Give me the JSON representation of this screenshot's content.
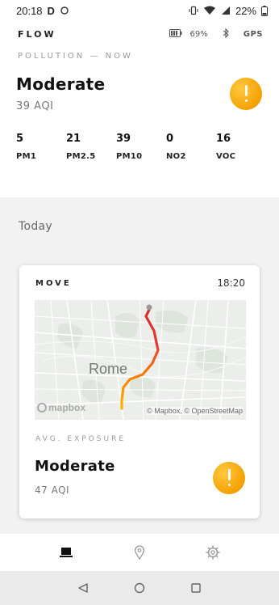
{
  "status_bar": {
    "time": "20:18",
    "battery": "22%"
  },
  "header": {
    "brand": "FLOW",
    "device_battery": "69%",
    "gps": "GPS"
  },
  "pollution": {
    "label": "POLLUTION — NOW",
    "level": "Moderate",
    "aqi": "39 AQI",
    "metrics": [
      {
        "value": "5",
        "name": "PM1"
      },
      {
        "value": "21",
        "name": "PM2.5"
      },
      {
        "value": "39",
        "name": "PM10"
      },
      {
        "value": "0",
        "name": "NO2"
      },
      {
        "value": "16",
        "name": "VOC"
      }
    ]
  },
  "today": {
    "label": "Today"
  },
  "move_card": {
    "title": "MOVE",
    "time": "18:20",
    "map": {
      "city": "Rome",
      "logo": "mapbox",
      "attribution": "© Mapbox, © OpenStreetMap"
    },
    "exposure_label": "AVG. EXPOSURE",
    "level": "Moderate",
    "aqi": "47 AQI"
  },
  "colors": {
    "alert": "#f5a000",
    "route_high": "#e53935",
    "route_mid": "#f57c00",
    "route_low": "#ffb300"
  },
  "icons": {
    "status": [
      "d-app-icon",
      "cloud-icon",
      "vibrate-icon",
      "wifi-icon",
      "signal-icon",
      "battery-icon"
    ],
    "header": [
      "device-battery-icon",
      "bluetooth-icon"
    ],
    "bottom_nav": [
      "timeline-icon",
      "map-pin-icon",
      "settings-gear-icon"
    ],
    "system_nav": [
      "back-icon",
      "home-icon",
      "recents-icon"
    ]
  }
}
